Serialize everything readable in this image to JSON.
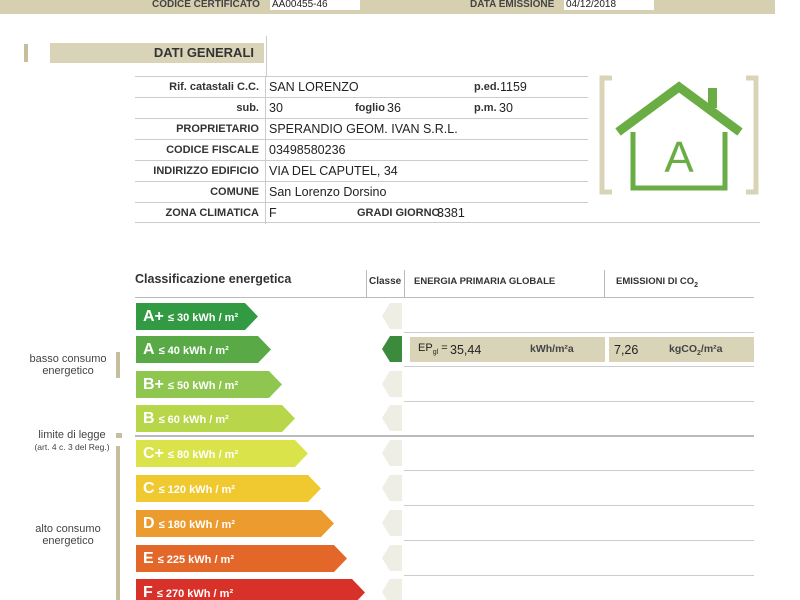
{
  "header": {
    "certificate_label": "CODICE CERTIFICATO",
    "certificate_value": "AA00455-46",
    "issue_label": "DATA EMISSIONE",
    "issue_value": "04/12/2018"
  },
  "general": {
    "title": "DATI GENERALI",
    "rows": {
      "cadastral": {
        "label": "Rif. catastali  C.C.",
        "value": "SAN LORENZO",
        "ped_label": "p.ed.",
        "ped_value": "1159"
      },
      "sub": {
        "label": "sub.",
        "value": "30",
        "sheet_label": "foglio",
        "sheet_value": "36",
        "pm_label": "p.m.",
        "pm_value": "30"
      },
      "owner": {
        "label": "PROPRIETARIO",
        "value": "SPERANDIO GEOM. IVAN S.R.L."
      },
      "tax_code": {
        "label": "CODICE FISCALE",
        "value": "03498580236"
      },
      "address": {
        "label": "INDIRIZZO EDIFICIO",
        "value": "VIA DEL CAPUTEL, 34"
      },
      "municipality": {
        "label": "COMUNE",
        "value": "San Lorenzo Dorsino"
      },
      "climate_zone": {
        "label": "ZONA CLIMATICA",
        "value": "F",
        "degree_days_label": "GRADI GIORNO",
        "degree_days_value": "3381"
      }
    }
  },
  "badge": {
    "letter": "A",
    "color": "#6aad45"
  },
  "classification": {
    "title": "Classificazione energetica",
    "class_col": "Classe",
    "ep_col": "ENERGIA PRIMARIA GLOBALE",
    "em_col": "EMISSIONI DI CO",
    "em_col_sub": "2",
    "classes": [
      {
        "cls": "A+",
        "range": "≤ 30 kWh / m²",
        "color": "#339a44"
      },
      {
        "cls": "A",
        "range": "≤ 40 kWh / m²",
        "color": "#5aa947"
      },
      {
        "cls": "B+",
        "range": "≤ 50 kWh / m²",
        "color": "#8ec64f"
      },
      {
        "cls": "B",
        "range": "≤ 60 kWh / m²",
        "color": "#b7d64a"
      },
      {
        "cls": "C+",
        "range": "≤ 80 kWh / m²",
        "color": "#dbe34a"
      },
      {
        "cls": "C",
        "range": "≤ 120 kWh / m²",
        "color": "#f0c930"
      },
      {
        "cls": "D",
        "range": "≤ 180 kWh / m²",
        "color": "#ec9b2e"
      },
      {
        "cls": "E",
        "range": "≤ 225 kWh / m²",
        "color": "#e4672a"
      },
      {
        "cls": "F",
        "range": "≤ 270 kWh / m²",
        "color": "#d8312a"
      }
    ],
    "active_class": "A",
    "ep_label": "EP",
    "ep_label_sub": "gl",
    "ep_value": "35,44",
    "ep_unit": "kWh/m²a",
    "em_value": "7,26",
    "em_unit": "kgCO",
    "em_unit_sub": "2",
    "em_unit_tail": "/m²a"
  },
  "sidebar": {
    "low": [
      "basso consumo",
      "energetico"
    ],
    "limit": "limite di legge",
    "limit_ref": "(art. 4 c. 3 del Reg.)",
    "high": [
      "alto consumo",
      "energetico"
    ]
  }
}
